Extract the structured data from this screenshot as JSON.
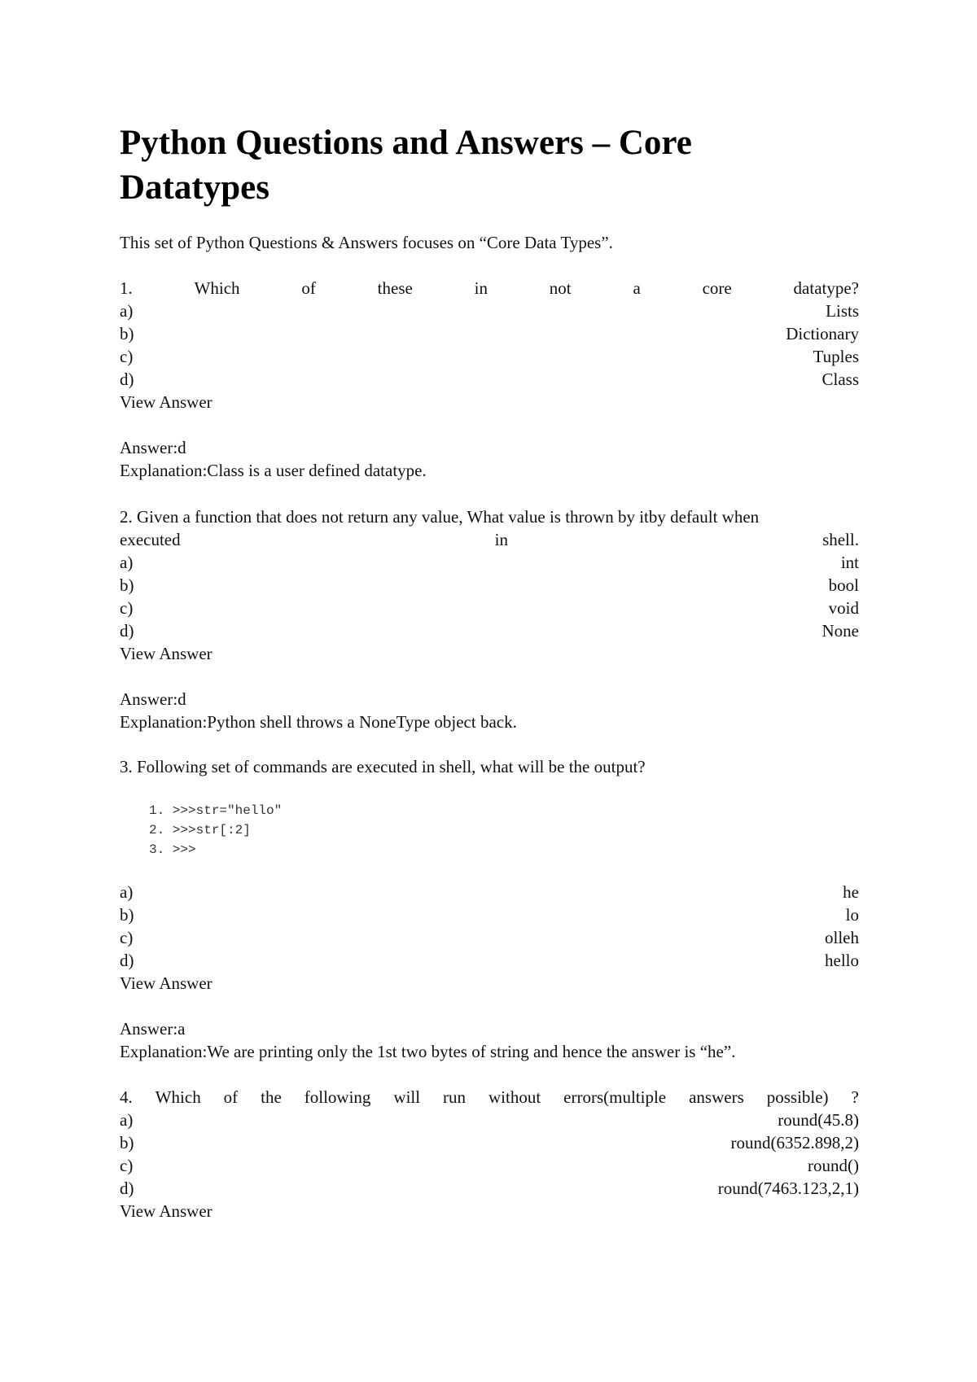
{
  "document": {
    "title_line1": "Python Questions and Answers – Core",
    "title_line2": "Datatypes",
    "intro": "This set of Python Questions & Answers focuses on “Core Data Types”."
  },
  "questions": [
    {
      "number": "1.",
      "words": [
        "1.",
        "Which",
        "of",
        "these",
        "in",
        "not",
        "a",
        "core",
        "datatype?"
      ],
      "options": [
        {
          "label": "a)",
          "text": "Lists"
        },
        {
          "label": "b)",
          "text": "Dictionary"
        },
        {
          "label": "c)",
          "text": "Tuples"
        },
        {
          "label": "d)",
          "text": "Class"
        }
      ],
      "view_answer": "View Answer",
      "answer": "Answer:d",
      "explanation": "Explanation:Class is a user defined datatype."
    },
    {
      "number": "2.",
      "line1": "2. Given a function that does not return any value, What value is thrown by itby default when",
      "line2_words": [
        "executed",
        "in",
        "shell."
      ],
      "options": [
        {
          "label": "a)",
          "text": "int"
        },
        {
          "label": "b)",
          "text": "bool"
        },
        {
          "label": "c)",
          "text": "void"
        },
        {
          "label": "d)",
          "text": "None"
        }
      ],
      "view_answer": "View Answer",
      "answer": "Answer:d",
      "explanation": "Explanation:Python shell throws a NoneType object back."
    },
    {
      "number": "3.",
      "text": "3. Following set of commands are executed in shell, what will be the output?",
      "code": [
        "1. >>>str=\"hello\"",
        "2. >>>str[:2]",
        "3. >>>"
      ],
      "options": [
        {
          "label": "a)",
          "text": "he"
        },
        {
          "label": "b)",
          "text": "lo"
        },
        {
          "label": "c)",
          "text": "olleh"
        },
        {
          "label": "d)",
          "text": "hello"
        }
      ],
      "view_answer": "View Answer",
      "answer": "Answer:a",
      "explanation": "Explanation:We are printing only the 1st two bytes of string and hence the answer is “he”."
    },
    {
      "number": "4.",
      "words": [
        "4.",
        "Which",
        "of",
        "the",
        "following",
        "will",
        "run",
        "without",
        "errors(multiple",
        "answers",
        "possible)",
        "?"
      ],
      "options": [
        {
          "label": "a)",
          "text": "round(45.8)"
        },
        {
          "label": "b)",
          "text": "round(6352.898,2)"
        },
        {
          "label": "c)",
          "text": "round()"
        },
        {
          "label": "d)",
          "text": "round(7463.123,2,1)"
        }
      ],
      "view_answer": "View Answer"
    }
  ]
}
